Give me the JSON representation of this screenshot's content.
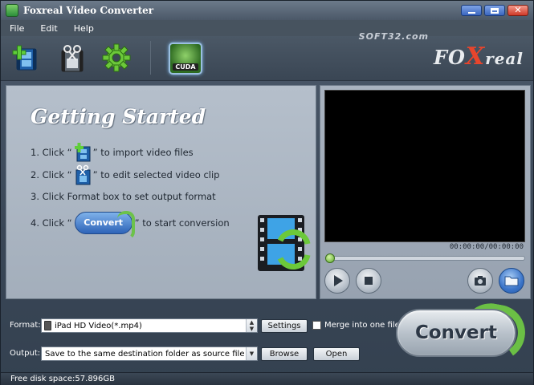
{
  "window": {
    "title": "Foxreal Video Converter",
    "controls": [
      "minimize",
      "maximize",
      "close"
    ]
  },
  "menu": [
    "File",
    "Edit",
    "Help"
  ],
  "watermark": "SOFT32.com",
  "toolbar": {
    "buttons": [
      {
        "name": "add-video-icon"
      },
      {
        "name": "edit-clip-icon"
      },
      {
        "name": "settings-gear-icon"
      }
    ],
    "cuda_label": "CUDA",
    "logo": {
      "fox": "FO",
      "x": "X",
      "real": "real"
    }
  },
  "getting_started": {
    "title": "Getting Started",
    "step1_pre": "1. Click “",
    "step1_post": "” to import video files",
    "step2_pre": "2. Click “",
    "step2_post": "” to edit selected video clip",
    "step3": "3. Click Format box to set output format",
    "step4_pre": "4. Click “",
    "step4_btn": "Convert",
    "step4_post": "” to start conversion"
  },
  "preview": {
    "time": "00:00:00/00:00:00",
    "progress": 0
  },
  "format": {
    "label": "Format:",
    "value": "iPad HD Video(*.mp4)",
    "settings_btn": "Settings",
    "merge_label": "Merge into one file",
    "merge_checked": false
  },
  "output": {
    "label": "Output:",
    "value": "Save to the same destination folder as source file",
    "browse_btn": "Browse",
    "open_btn": "Open"
  },
  "convert_label": "Convert",
  "status": "Free disk space:57.896GB"
}
